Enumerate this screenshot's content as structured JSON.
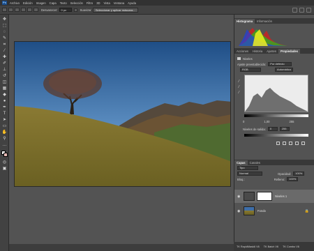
{
  "menubar": {
    "logo": "Ps",
    "items": [
      "Archivo",
      "Edición",
      "Imagen",
      "Capa",
      "Texto",
      "Selección",
      "Filtro",
      "3D",
      "Vista",
      "Ventana",
      "Ayuda"
    ]
  },
  "options": {
    "feather_label": "Desvanecer:",
    "feather_value": "0 px",
    "antialias_label": "Suavizar",
    "select_mask_button": "Seleccionar y aplicar máscara..."
  },
  "histogram_panel": {
    "tabs": [
      "Histograma",
      "Información"
    ]
  },
  "properties_panel": {
    "tabs": [
      "Acciones",
      "Historia",
      "Ajustes",
      "Propiedades"
    ],
    "adjustment_name": "Niveles",
    "preset_label": "Ajuste preestablecido:",
    "preset_value": "Por defecto",
    "channel_value": "RGB",
    "auto_button": "Automático",
    "input_black": "0",
    "input_mid": "1,00",
    "input_white": "255",
    "output_label": "Niveles de salida:",
    "output_black": "0",
    "output_white": "255"
  },
  "layers_panel": {
    "tabs": [
      "Capas",
      "Canales"
    ],
    "filter_value": "Tipo",
    "blend_mode": "Normal",
    "opacity_label": "Opacidad:",
    "opacity_value": "100%",
    "lock_label": "Bloq.:",
    "fill_label": "Relleno:",
    "fill_value": "100%",
    "layers": [
      {
        "name": "Niveles 1"
      },
      {
        "name": "Fondo"
      }
    ]
  },
  "status_tabs": [
    "TK RapidMask6 V6",
    "TK Batch V6",
    "TK Combo V6"
  ],
  "colors": {
    "accent": "#1b4d8c",
    "foreground": "#ffffff",
    "background": "#e4b7b3"
  }
}
